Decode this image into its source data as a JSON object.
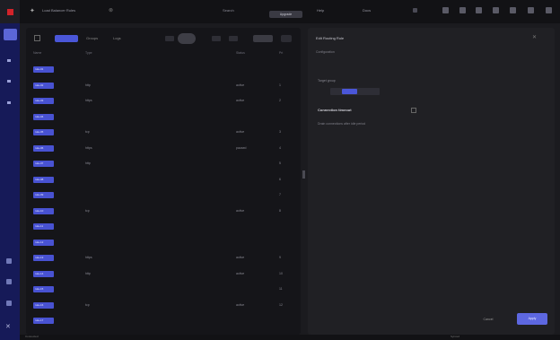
{
  "app": {
    "window_title": "Load Balancer Rules"
  },
  "topbar": {
    "search_label": "Search",
    "pill_label": "Upgrade",
    "links": [
      "Help",
      "Docs"
    ]
  },
  "list": {
    "tabs": [
      "Rules",
      "Groups",
      "Logs"
    ],
    "columns": [
      "Name",
      "Type",
      "Status",
      "Pri"
    ],
    "rows": [
      {
        "name": "rule-01",
        "type": "",
        "status": "",
        "pri": ""
      },
      {
        "name": "rule-02",
        "type": "http",
        "status": "active",
        "pri": "1"
      },
      {
        "name": "rule-03",
        "type": "https",
        "status": "active",
        "pri": "2"
      },
      {
        "name": "rule-04",
        "type": "",
        "status": "",
        "pri": ""
      },
      {
        "name": "rule-05",
        "type": "tcp",
        "status": "active",
        "pri": "3"
      },
      {
        "name": "rule-06",
        "type": "https",
        "status": "paused",
        "pri": "4"
      },
      {
        "name": "rule-07",
        "type": "http",
        "status": "",
        "pri": "5"
      },
      {
        "name": "rule-08",
        "type": "",
        "status": "",
        "pri": "6"
      },
      {
        "name": "rule-09",
        "type": "",
        "status": "",
        "pri": "7"
      },
      {
        "name": "rule-10",
        "type": "tcp",
        "status": "active",
        "pri": "8"
      },
      {
        "name": "rule-11",
        "type": "",
        "status": "",
        "pri": ""
      },
      {
        "name": "rule-12",
        "type": "",
        "status": "",
        "pri": ""
      },
      {
        "name": "rule-13",
        "type": "https",
        "status": "active",
        "pri": "9"
      },
      {
        "name": "rule-14",
        "type": "http",
        "status": "active",
        "pri": "10"
      },
      {
        "name": "rule-15",
        "type": "",
        "status": "",
        "pri": "11"
      },
      {
        "name": "rule-16",
        "type": "tcp",
        "status": "active",
        "pri": "12"
      },
      {
        "name": "rule-17",
        "type": "",
        "status": "",
        "pri": ""
      }
    ]
  },
  "details": {
    "title": "Edit Routing Rule",
    "subtitle": "Configuration",
    "field_label": "Target group",
    "section_title": "Connection timeout",
    "section_text": "Drain connections after idle period",
    "cancel_label": "Cancel",
    "apply_label": "Apply"
  },
  "status": {
    "left": "Connected",
    "right": "Synced"
  },
  "colors": {
    "accent": "#4852d2",
    "rail": "#161a58",
    "logo": "#d2232a"
  }
}
